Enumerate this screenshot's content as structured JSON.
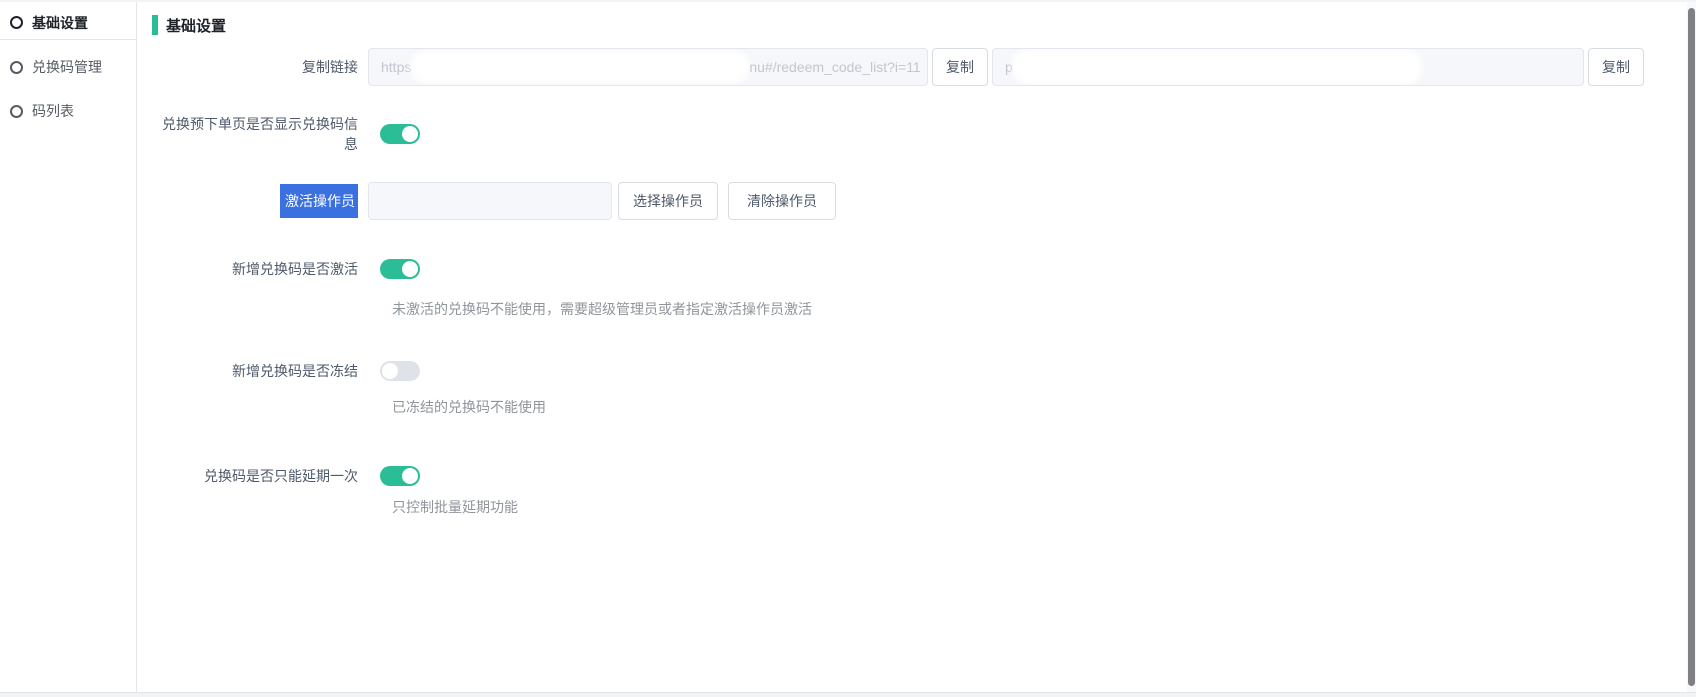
{
  "sidebar": {
    "items": [
      {
        "label": "基础设置",
        "active": true
      },
      {
        "label": "兑换码管理",
        "active": false
      },
      {
        "label": "码列表",
        "active": false
      }
    ]
  },
  "page": {
    "title": "基础设置"
  },
  "form": {
    "copy_link": {
      "label": "复制链接",
      "input1_visible_prefix": "https",
      "input1_visible_suffix": "nu#/redeem_code_list?i=11",
      "input2_visible_prefix": "p",
      "copy_button_label": "复制"
    },
    "show_code_info": {
      "label": "兑换预下单页是否显示兑换码信息",
      "state": "on"
    },
    "activate_operator": {
      "label": "激活操作员",
      "input_value": "",
      "select_button_label": "选择操作员",
      "clear_button_label": "清除操作员"
    },
    "new_code_activated": {
      "label": "新增兑换码是否激活",
      "state": "on",
      "hint": "未激活的兑换码不能使用，需要超级管理员或者指定激活操作员激活"
    },
    "new_code_frozen": {
      "label": "新增兑换码是否冻结",
      "state": "off",
      "hint": "已冻结的兑换码不能使用"
    },
    "postpone_once": {
      "label": "兑换码是否只能延期一次",
      "state": "on",
      "hint": "只控制批量延期功能"
    }
  },
  "colors": {
    "accent": "#2bbe96",
    "selection": "#3b70e0",
    "toggle_off": "#dfe2e8",
    "scrollbar_thumb": "#7f8084"
  }
}
